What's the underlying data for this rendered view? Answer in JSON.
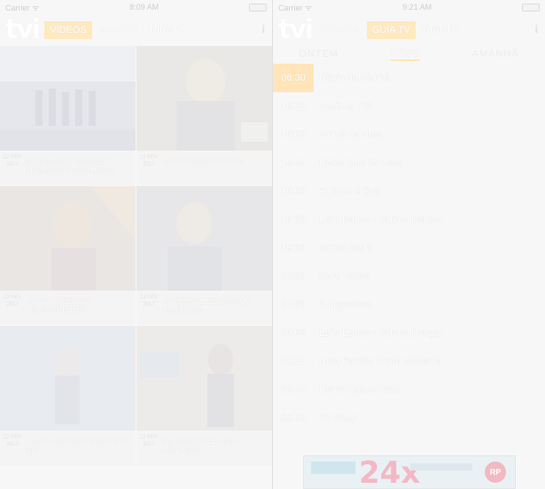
{
  "left_screen": {
    "status": {
      "carrier": "Carrier ᯤ",
      "time": "8:09 AM"
    },
    "nav": {
      "logo": "tvi",
      "items": [
        "VÍDEOS",
        "GUIA TV",
        "DIRETO"
      ],
      "active": 0,
      "info": "i"
    },
    "videos": [
      {
        "date": "12 FEV 2017",
        "title": "INÊS SANTOS VENCEU O SEGUNDO PROGRAMA ES..."
      },
      {
        "date": "12 FEV 2017",
        "title": "AS VOTAÇÕES DO JÚRI"
      },
      {
        "date": "12 FEV 2017",
        "title": "AS VOTAÇÕES DOS CONCORRENTES"
      },
      {
        "date": "12 FEV 2017",
        "title": "ALGUÉM SE DECLAROU À NAMORADA"
      },
      {
        "date": "12 FEV 2017",
        "title": "DIANA MONTEIRO COMO DUA LIPA"
      },
      {
        "date": "12 FEV 2017",
        "title": "OS ENSAIOS DE DIANA MONTEIRO"
      }
    ]
  },
  "right_screen": {
    "status": {
      "carrier": "Carrier ᯤ",
      "time": "9:21 AM"
    },
    "nav": {
      "logo": "tvi",
      "items": [
        "VÍDEOS",
        "GUIA TV",
        "DIRETO"
      ],
      "active": 1,
      "info": "i"
    },
    "days": [
      "ONTEM",
      "HOJE",
      "AMANHÃ"
    ],
    "active_day": 1,
    "schedule": [
      {
        "time": "06:30",
        "title": "Diário da Manhã",
        "current": true
      },
      {
        "time": "10:10",
        "title": "Você na TV!"
      },
      {
        "time": "13:00",
        "title": "Jornal da Uma"
      },
      {
        "time": "14:43",
        "title": "Deixa Que Te Leve"
      },
      {
        "time": "16:00",
        "title": "A Tarde é Sua"
      },
      {
        "time": "19:30",
        "title": "Let's Dance - Vamos Dançar"
      },
      {
        "time": "19:58",
        "title": "Jornal das 8"
      },
      {
        "time": "21:39",
        "title": "Ouro Verde"
      },
      {
        "time": "22:58",
        "title": "A Impostora"
      },
      {
        "time": "00:00",
        "title": "Let's Dance - Vamos Dançar"
      },
      {
        "time": "01:15",
        "title": "Uma Família muito Moderna"
      },
      {
        "time": "02:45",
        "title": "Dei-te Quase Tudo"
      },
      {
        "time": "05:00",
        "title": "TV Shop"
      }
    ],
    "ad": {
      "headline": "24x",
      "badge": "RP"
    }
  },
  "colors": {
    "accent": "#ffe9bf",
    "background": "#f7f7f7"
  }
}
